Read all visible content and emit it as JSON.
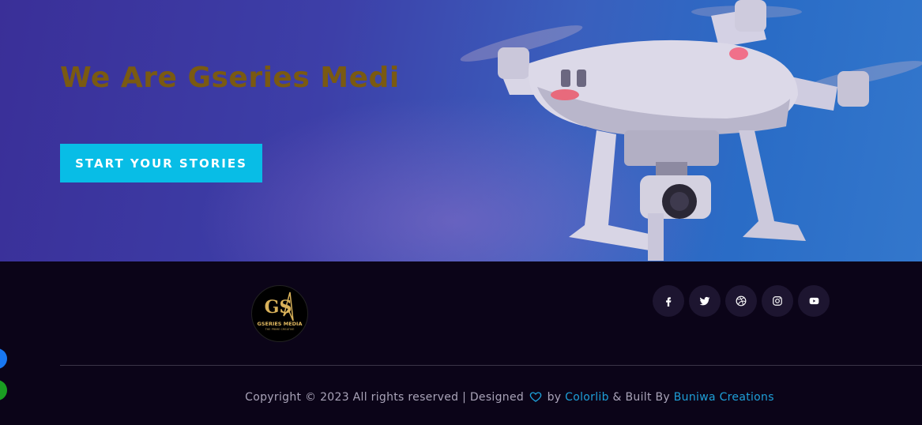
{
  "hero": {
    "title": "We Are Gseries Medi",
    "cta_label": "START YOUR STORIES"
  },
  "footer": {
    "logo": {
      "monogram": "GS",
      "name": "GSERIES MEDIA",
      "tagline": "THE PRIME CREATIVE"
    },
    "socials": [
      {
        "name": "facebook",
        "icon": "facebook-icon"
      },
      {
        "name": "twitter",
        "icon": "twitter-icon"
      },
      {
        "name": "dribbble",
        "icon": "dribbble-icon"
      },
      {
        "name": "instagram",
        "icon": "instagram-icon"
      },
      {
        "name": "youtube",
        "icon": "youtube-icon"
      }
    ],
    "copyright": {
      "prefix": "Copyright © 2023 All rights reserved | Designed",
      "by": "by",
      "designer": "Colorlib",
      "built_by": "& Built By",
      "builder": "Buniwa Creations"
    }
  },
  "colors": {
    "hero_title": "#7a5a12",
    "cta_bg": "#08bde6",
    "footer_bg": "#0b0418",
    "link": "#1e9fd8",
    "side_dot_blue": "#1877f2",
    "side_dot_green": "#1a9e22"
  },
  "side_widgets": [
    {
      "name": "messenger-widget",
      "icon": "messenger-icon"
    },
    {
      "name": "whatsapp-widget",
      "icon": "whatsapp-icon"
    }
  ]
}
